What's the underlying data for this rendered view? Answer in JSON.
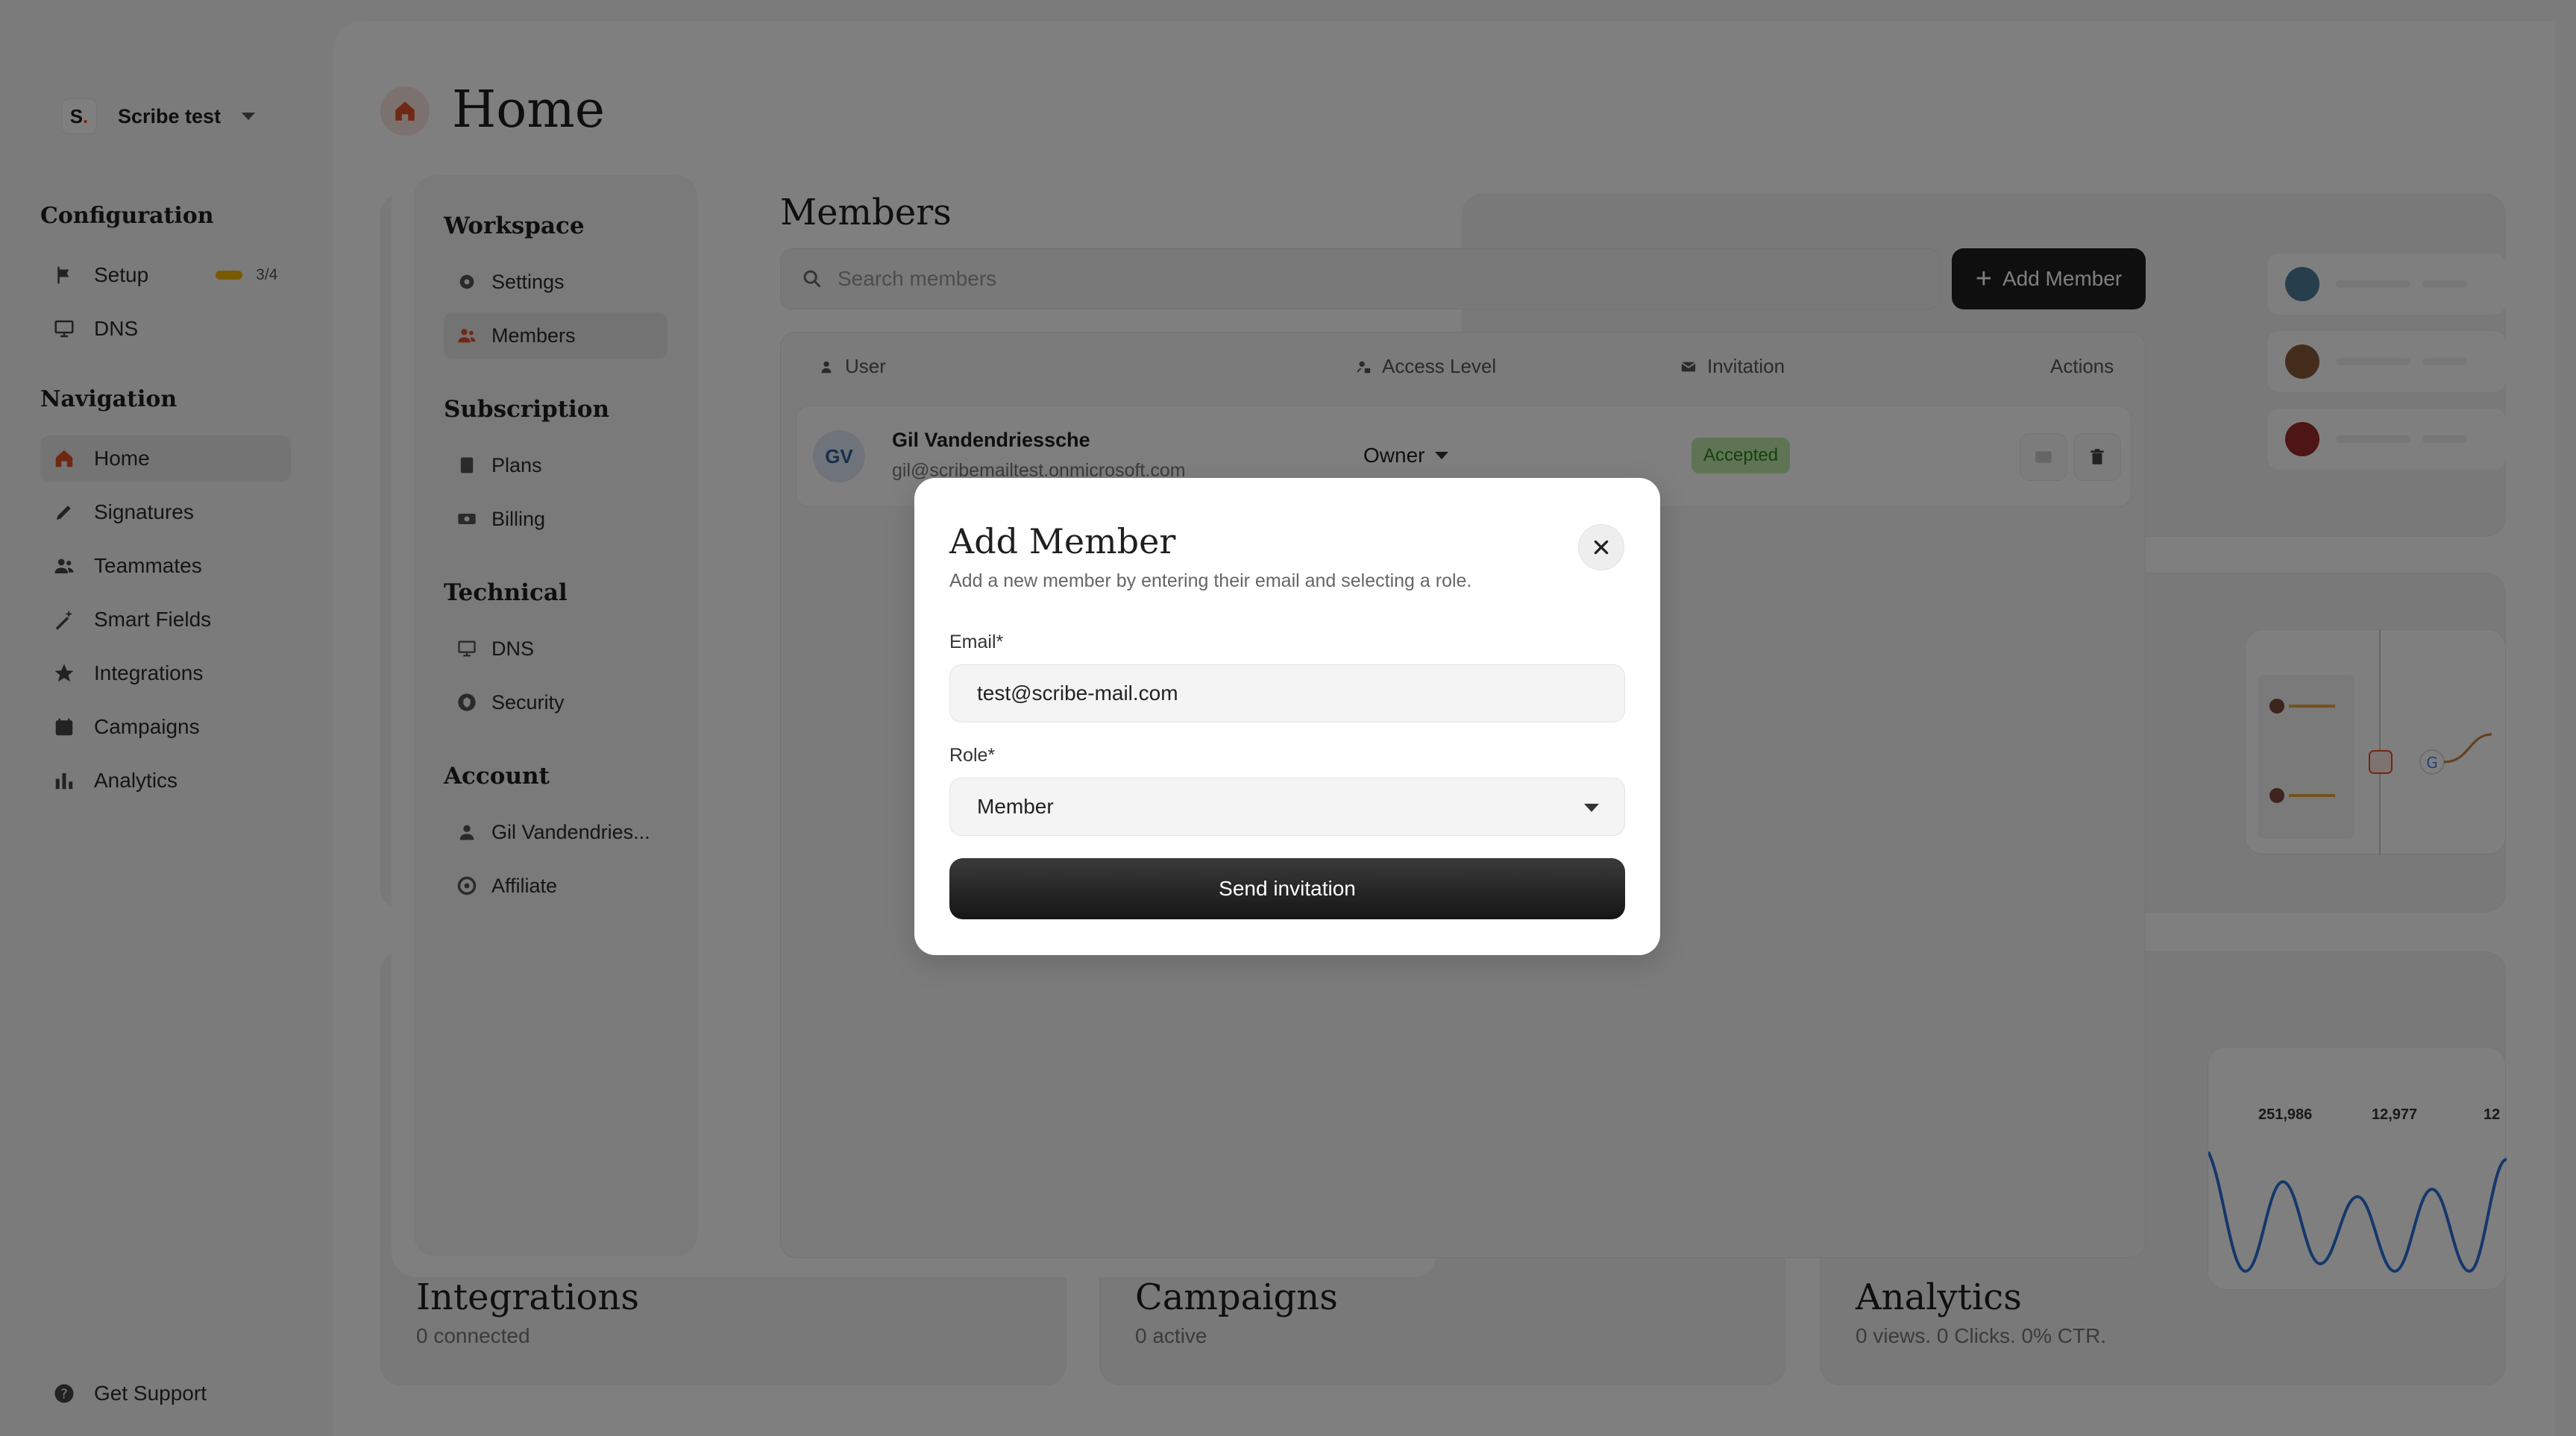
{
  "workspace": {
    "logo_text": "S",
    "logo_dot": ".",
    "name": "Scribe test"
  },
  "sidebar": {
    "configuration_heading": "Configuration",
    "setup_label": "Setup",
    "setup_progress": "3/4",
    "dns_label": "DNS",
    "navigation_heading": "Navigation",
    "nav": [
      "Home",
      "Signatures",
      "Teammates",
      "Smart Fields",
      "Integrations",
      "Campaigns",
      "Analytics"
    ],
    "support_label": "Get Support"
  },
  "home": {
    "title": "Home",
    "integrations": {
      "title": "Integrations",
      "sub": "0 connected"
    },
    "campaigns": {
      "title": "Campaigns",
      "sub": "0 active"
    },
    "analytics": {
      "title": "Analytics",
      "sub": "0 views. 0 Clicks. 0% CTR."
    },
    "stats": [
      "251,986",
      "12,977",
      "12"
    ]
  },
  "settings": {
    "workspace_heading": "Workspace",
    "settings_label": "Settings",
    "members_label": "Members",
    "subscription_heading": "Subscription",
    "plans_label": "Plans",
    "billing_label": "Billing",
    "technical_heading": "Technical",
    "dns_label": "DNS",
    "security_label": "Security",
    "account_heading": "Account",
    "account_name": "Gil Vandendries...",
    "affiliate_label": "Affiliate"
  },
  "members": {
    "title": "Members",
    "search_placeholder": "Search members",
    "add_button": "Add Member",
    "columns": {
      "user": "User",
      "access": "Access Level",
      "invitation": "Invitation",
      "actions": "Actions"
    },
    "rows": [
      {
        "initials": "GV",
        "name": "Gil Vandendriessche",
        "email": "gil@scribemailtest.onmicrosoft.com",
        "role": "Owner",
        "status": "Accepted"
      }
    ]
  },
  "dialog": {
    "title": "Add Member",
    "description": "Add a new member by entering their email and selecting a role.",
    "email_label": "Email*",
    "email_value": "test@scribe-mail.com",
    "role_label": "Role*",
    "role_value": "Member",
    "submit_label": "Send invitation"
  },
  "colors": {
    "accent": "#e0502a",
    "primary_button": "#1f1f1f",
    "accepted_badge": "#bfe9a8"
  }
}
